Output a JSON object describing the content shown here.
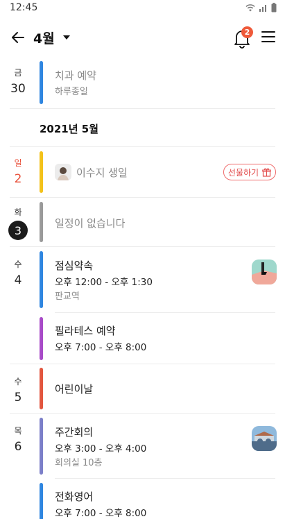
{
  "status_bar": {
    "time": "12:45"
  },
  "header": {
    "month": "4월",
    "notification_count": "2"
  },
  "entries": {
    "fri30": {
      "dow": "금",
      "day": "30",
      "title": "치과 예약",
      "sub": "하루종일"
    },
    "month_label": "2021년 5월",
    "sun2": {
      "dow": "일",
      "day": "2",
      "title": "이수지 생일",
      "gift": "선물하기"
    },
    "tue3": {
      "dow": "화",
      "day": "3",
      "title": "일정이 없습니다"
    },
    "wed4a": {
      "dow": "수",
      "day": "4",
      "title": "점심약속",
      "time": "오후 12:00 - 오후 1:30",
      "location": "판교역"
    },
    "wed4b": {
      "title": "필라테스 예약",
      "time": "오후 7:00 - 오후 8:00"
    },
    "wed5": {
      "dow": "수",
      "day": "5",
      "title": "어린이날"
    },
    "thu6a": {
      "dow": "목",
      "day": "6",
      "title": "주간회의",
      "time": "오후 3:00 - 오후 4:00",
      "location": "회의실 10층"
    },
    "thu6b": {
      "title": "전화영어",
      "time": "오후 7:00 - 오후 8:00"
    }
  },
  "colors": {
    "blue": "#2f86e0",
    "yellow": "#f3c21a",
    "gray": "#9a9a9a",
    "purple": "#a84bc8",
    "red": "#e2563f",
    "indigo": "#7c7fc9",
    "accent": "#ef5a3a"
  }
}
